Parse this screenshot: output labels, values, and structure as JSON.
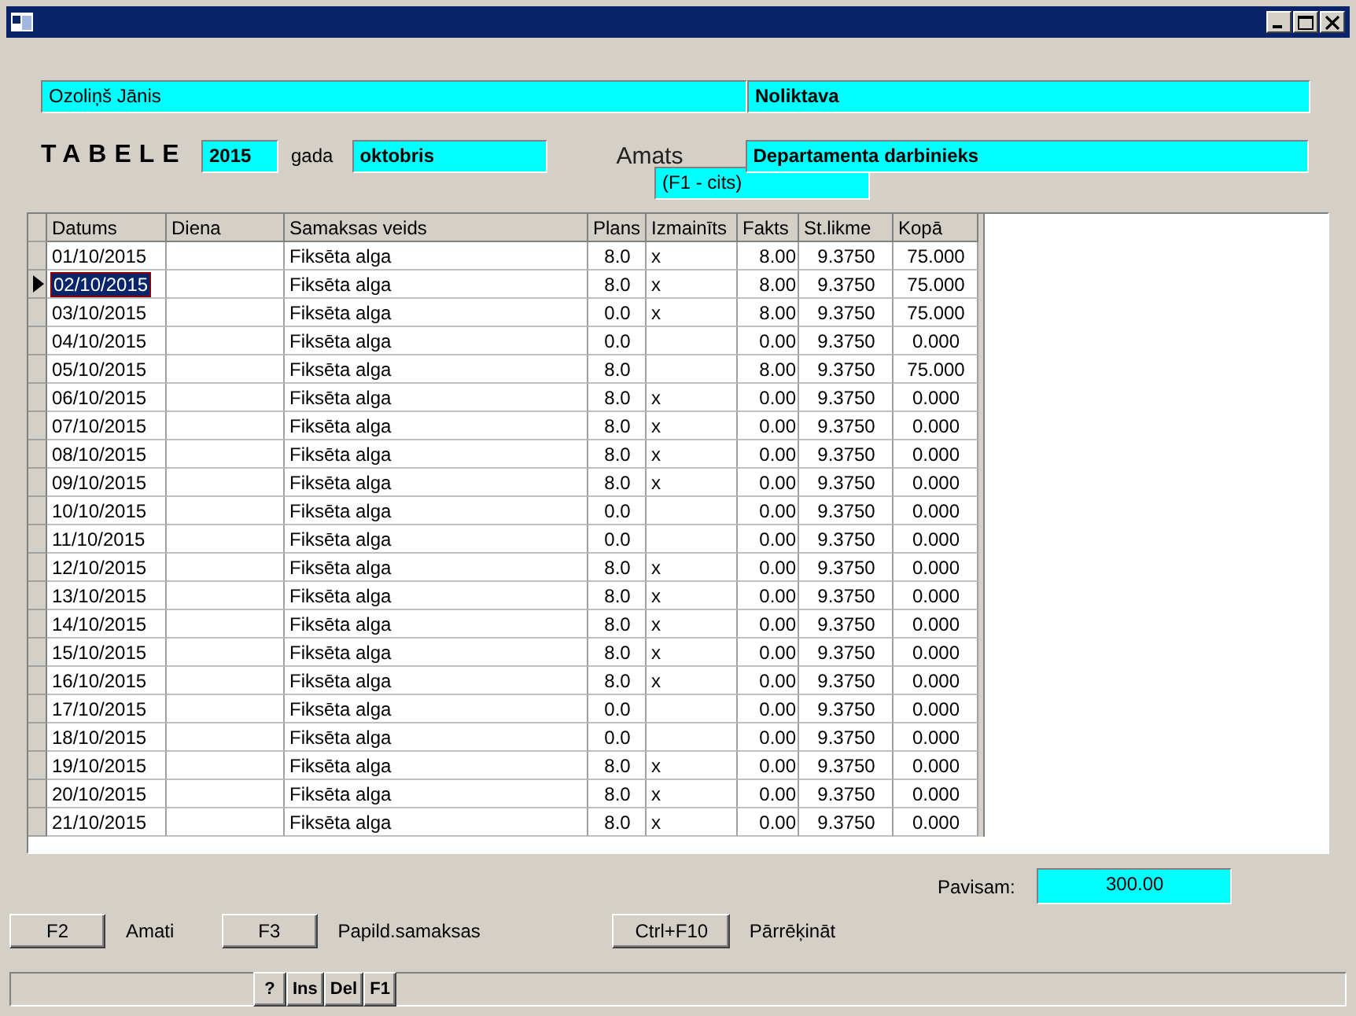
{
  "header": {
    "employee": "Ozoliņš Jānis",
    "department": "Noliktava"
  },
  "period": {
    "title": "TABELE",
    "year": "2015",
    "year_label": "gada",
    "month": "oktobris",
    "position_label": "Amats",
    "position": "Departamenta darbinieks",
    "position_hint": "(F1 - cits)"
  },
  "table": {
    "columns": [
      "Datums",
      "Diena",
      "Samaksas veids",
      "Plans",
      "Izmainīts",
      "Fakts",
      "St.likme",
      "Kopā"
    ],
    "rows": [
      {
        "selected": false,
        "cells": [
          "01/10/2015",
          "",
          "Fiksēta alga",
          "8.0",
          "x",
          "8.00",
          "9.3750",
          "75.000"
        ]
      },
      {
        "selected": true,
        "cells": [
          "02/10/2015",
          "",
          "Fiksēta alga",
          "8.0",
          "x",
          "8.00",
          "9.3750",
          "75.000"
        ]
      },
      {
        "selected": false,
        "cells": [
          "03/10/2015",
          "",
          "Fiksēta alga",
          "0.0",
          "x",
          "8.00",
          "9.3750",
          "75.000"
        ]
      },
      {
        "selected": false,
        "cells": [
          "04/10/2015",
          "",
          "Fiksēta alga",
          "0.0",
          "",
          "0.00",
          "9.3750",
          "0.000"
        ]
      },
      {
        "selected": false,
        "cells": [
          "05/10/2015",
          "",
          "Fiksēta alga",
          "8.0",
          "",
          "8.00",
          "9.3750",
          "75.000"
        ]
      },
      {
        "selected": false,
        "cells": [
          "06/10/2015",
          "",
          "Fiksēta alga",
          "8.0",
          "x",
          "0.00",
          "9.3750",
          "0.000"
        ]
      },
      {
        "selected": false,
        "cells": [
          "07/10/2015",
          "",
          "Fiksēta alga",
          "8.0",
          "x",
          "0.00",
          "9.3750",
          "0.000"
        ]
      },
      {
        "selected": false,
        "cells": [
          "08/10/2015",
          "",
          "Fiksēta alga",
          "8.0",
          "x",
          "0.00",
          "9.3750",
          "0.000"
        ]
      },
      {
        "selected": false,
        "cells": [
          "09/10/2015",
          "",
          "Fiksēta alga",
          "8.0",
          "x",
          "0.00",
          "9.3750",
          "0.000"
        ]
      },
      {
        "selected": false,
        "cells": [
          "10/10/2015",
          "",
          "Fiksēta alga",
          "0.0",
          "",
          "0.00",
          "9.3750",
          "0.000"
        ]
      },
      {
        "selected": false,
        "cells": [
          "11/10/2015",
          "",
          "Fiksēta alga",
          "0.0",
          "",
          "0.00",
          "9.3750",
          "0.000"
        ]
      },
      {
        "selected": false,
        "cells": [
          "12/10/2015",
          "",
          "Fiksēta alga",
          "8.0",
          "x",
          "0.00",
          "9.3750",
          "0.000"
        ]
      },
      {
        "selected": false,
        "cells": [
          "13/10/2015",
          "",
          "Fiksēta alga",
          "8.0",
          "x",
          "0.00",
          "9.3750",
          "0.000"
        ]
      },
      {
        "selected": false,
        "cells": [
          "14/10/2015",
          "",
          "Fiksēta alga",
          "8.0",
          "x",
          "0.00",
          "9.3750",
          "0.000"
        ]
      },
      {
        "selected": false,
        "cells": [
          "15/10/2015",
          "",
          "Fiksēta alga",
          "8.0",
          "x",
          "0.00",
          "9.3750",
          "0.000"
        ]
      },
      {
        "selected": false,
        "cells": [
          "16/10/2015",
          "",
          "Fiksēta alga",
          "8.0",
          "x",
          "0.00",
          "9.3750",
          "0.000"
        ]
      },
      {
        "selected": false,
        "cells": [
          "17/10/2015",
          "",
          "Fiksēta alga",
          "0.0",
          "",
          "0.00",
          "9.3750",
          "0.000"
        ]
      },
      {
        "selected": false,
        "cells": [
          "18/10/2015",
          "",
          "Fiksēta alga",
          "0.0",
          "",
          "0.00",
          "9.3750",
          "0.000"
        ]
      },
      {
        "selected": false,
        "cells": [
          "19/10/2015",
          "",
          "Fiksēta alga",
          "8.0",
          "x",
          "0.00",
          "9.3750",
          "0.000"
        ]
      },
      {
        "selected": false,
        "cells": [
          "20/10/2015",
          "",
          "Fiksēta alga",
          "8.0",
          "x",
          "0.00",
          "9.3750",
          "0.000"
        ]
      },
      {
        "selected": false,
        "cells": [
          "21/10/2015",
          "",
          "Fiksēta alga",
          "8.0",
          "x",
          "0.00",
          "9.3750",
          "0.000"
        ]
      }
    ]
  },
  "total": {
    "label": "Pavisam:",
    "value": "300.00"
  },
  "actions": [
    {
      "key": "F2",
      "label": "Amati"
    },
    {
      "key": "F3",
      "label": "Papild.samaksas"
    },
    {
      "key": "Ctrl+F10",
      "label": "Pārrēķināt"
    }
  ],
  "status_bar": {
    "buttons": [
      "?",
      "Ins",
      "Del",
      "F1"
    ]
  }
}
